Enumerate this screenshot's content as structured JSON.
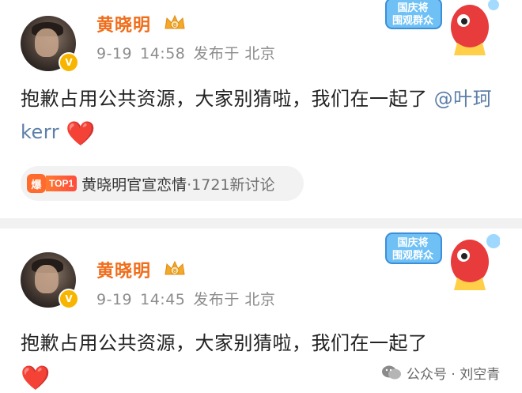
{
  "posts": [
    {
      "username": "黄晓明",
      "verified_badge": "V",
      "date": "9-19",
      "time": "14:58",
      "location": "发布于 北京",
      "text": "抱歉占用公共资源，大家别猜啦，我们在一起了",
      "mention": "@叶珂 kerr",
      "emoji": "❤️",
      "hot_topic": {
        "badge_char": "爆",
        "badge_rank": "TOP1",
        "title": "黄晓明官宣恋情",
        "count": "·1721新讨论"
      },
      "sticker": {
        "line1": "国庆将",
        "line2": "围观群众"
      }
    },
    {
      "username": "黄晓明",
      "verified_badge": "V",
      "date": "9-19",
      "time": "14:45",
      "location": "发布于 北京",
      "text": "抱歉占用公共资源，大家别猜啦，我们在一起了",
      "emoji": "❤️",
      "sticker": {
        "line1": "国庆将",
        "line2": "围观群众"
      }
    }
  ],
  "watermark": {
    "text": "公众号 · 刘空青",
    "icon": "wechat-icon"
  },
  "colors": {
    "username": "#f06d1a",
    "mention": "#5d7fa8",
    "meta": "#8c8c8c",
    "divider": "#f1f1f1",
    "heart": "#e8212f",
    "hot_badge": "#ff6b2d"
  }
}
